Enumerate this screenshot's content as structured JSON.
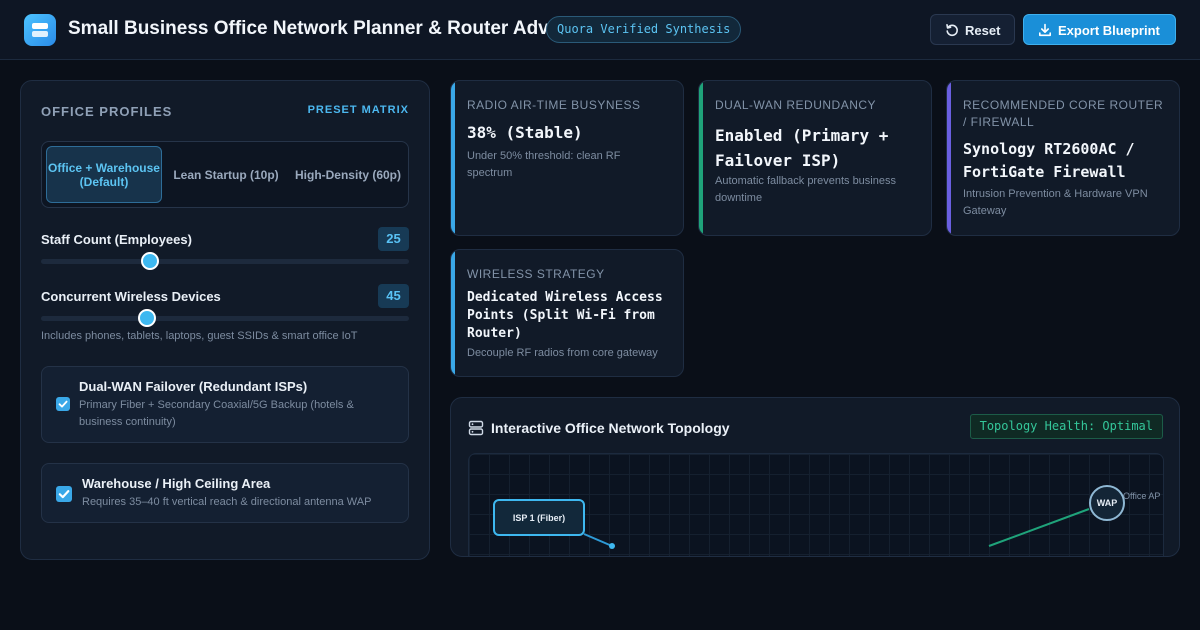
{
  "app": {
    "title": "Small Business Office Network Planner & Router Advisor",
    "badge": "Quora Verified Synthesis"
  },
  "toolbar": {
    "reset_label": "Reset",
    "export_label": "Export Blueprint"
  },
  "profiles": {
    "section_title": "OFFICE PROFILES",
    "preset_link": "PRESET MATRIX",
    "tabs": [
      {
        "label": "Office + Warehouse (Default)",
        "active": true
      },
      {
        "label": "Lean Startup (10p)",
        "active": false
      },
      {
        "label": "High-Density (60p)",
        "active": false
      }
    ]
  },
  "sliders": {
    "staff": {
      "label": "Staff Count (Employees)",
      "value": "25",
      "fraction": 0.295
    },
    "devices": {
      "label": "Concurrent Wireless Devices",
      "value": "45",
      "fraction": 0.288,
      "hint": "Includes phones, tablets, laptops, guest SSIDs & smart office IoT"
    }
  },
  "options": {
    "dual_wan": {
      "checked": true,
      "title": "Dual-WAN Failover (Redundant ISPs)",
      "desc": "Primary Fiber + Secondary Coaxial/5G Backup (hotels & business continuity)"
    },
    "warehouse": {
      "checked": true,
      "title": "Warehouse / High Ceiling Area",
      "desc": "Requires 35–40 ft vertical reach & directional antenna WAP"
    }
  },
  "stats": {
    "radio": {
      "label": "RADIO AIR-TIME BUSYNESS",
      "value": "38% (Stable)",
      "desc": "Under 50% threshold: clean RF spectrum",
      "accent": "#3aa8e8"
    },
    "dualwan": {
      "label": "DUAL-WAN REDUNDANCY",
      "value": "Enabled (Primary + Failover ISP)",
      "desc": "Automatic fallback prevents business downtime",
      "accent": "#1fa37a"
    },
    "router": {
      "label": "RECOMMENDED CORE ROUTER / FIREWALL",
      "value": "Synology RT2600AC / FortiGate Firewall",
      "desc": "Intrusion Prevention & Hardware VPN Gateway",
      "accent": "#6a5fe0"
    },
    "wireless": {
      "label": "WIRELESS STRATEGY",
      "value": "Dedicated Wireless Access Points (Split Wi-Fi from Router)",
      "desc": "Decouple RF radios from core gateway",
      "accent": "#3aa8e8"
    }
  },
  "topology": {
    "title": "Interactive Office Network Topology",
    "health": "Topology Health: Optimal",
    "nodes": {
      "isp1": "ISP 1 (Fiber)",
      "wap": "WAP",
      "wap_caption": "Office AP"
    }
  }
}
